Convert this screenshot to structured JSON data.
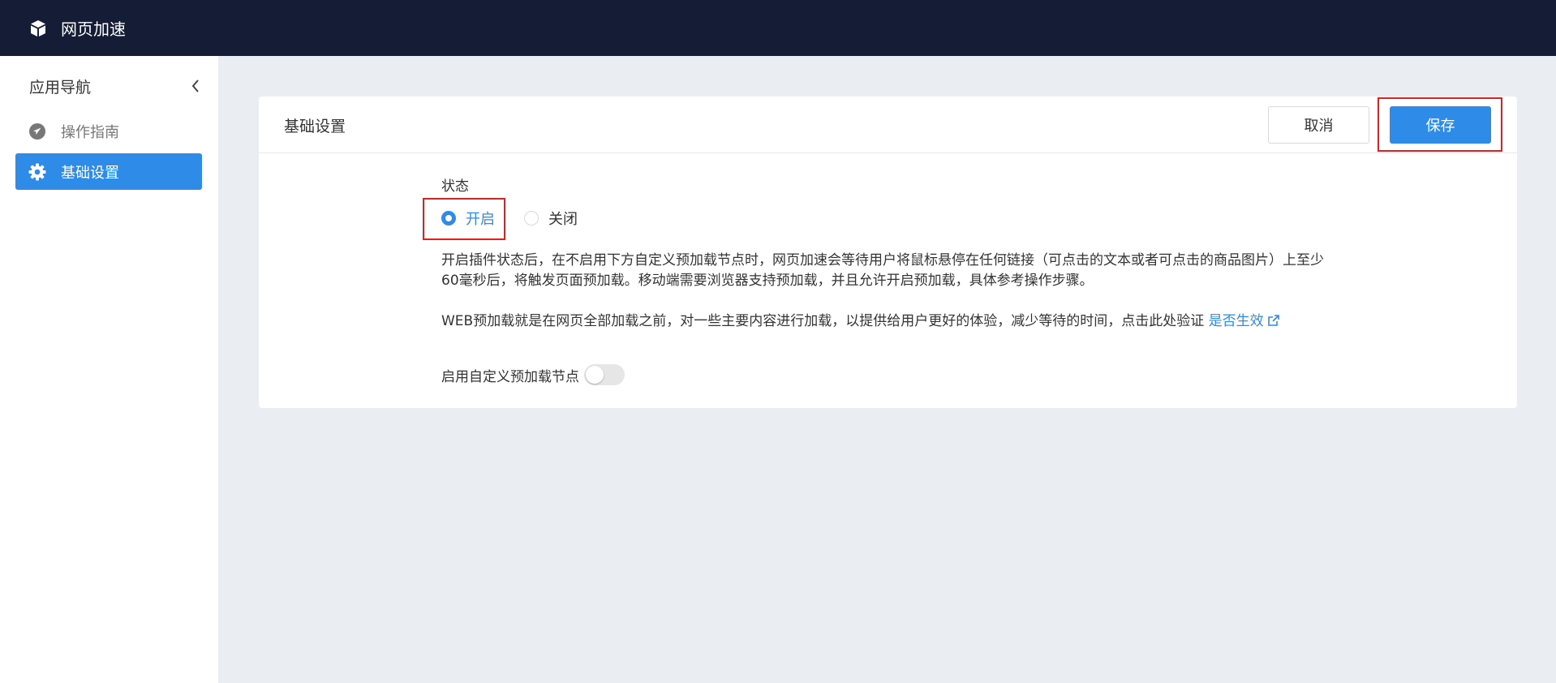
{
  "app": {
    "title": "网页加速"
  },
  "sidebar": {
    "title": "应用导航",
    "items": [
      {
        "label": "操作指南",
        "icon": "navigation-arrow-icon",
        "active": false
      },
      {
        "label": "基础设置",
        "icon": "gear-icon",
        "active": true
      }
    ]
  },
  "card": {
    "title": "基础设置",
    "cancel_label": "取消",
    "save_label": "保存"
  },
  "status": {
    "label": "状态",
    "options": [
      "开启",
      "关闭"
    ],
    "selected": "开启"
  },
  "description": {
    "line1": "开启插件状态后，在不启用下方自定义预加载节点时，网页加速会等待用户将鼠标悬停在任何链接（可点击的文本或者可点击的商品图片）上至少60毫秒后，将触发页面预加载。移动端需要浏览器支持预加载，并且允许开启预加载，具体参考操作步骤。",
    "line2": "WEB预加载就是在网页全部加载之前，对一些主要内容进行加载，以提供给用户更好的体验，减少等待的时间，点击此处验证 ",
    "link_text": "是否生效"
  },
  "custom_node": {
    "label": "启用自定义预加载节点",
    "enabled": false
  },
  "colors": {
    "topbar": "#151d36",
    "accent": "#2e8ce8",
    "highlight": "#e02020",
    "background": "#eaedf2"
  }
}
